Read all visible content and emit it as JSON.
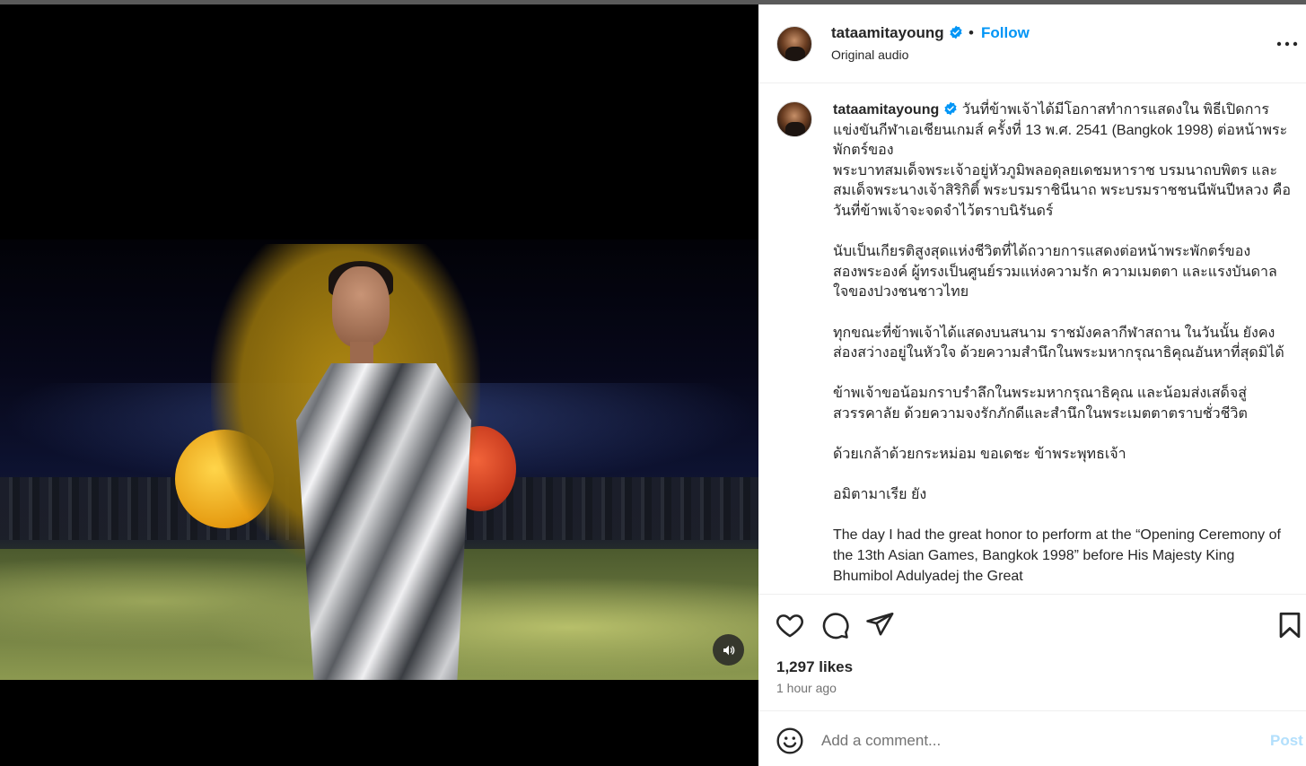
{
  "header": {
    "username": "tataamitayoung",
    "separator": "•",
    "follow_label": "Follow",
    "subtitle": "Original audio"
  },
  "caption": {
    "username": "tataamitayoung",
    "paragraphs": [
      "วันที่ข้าพเจ้าได้มีโอกาสทำการแสดงใน พิธีเปิดการแข่งขันกีฬาเอเชียนเกมส์ ครั้งที่ 13 พ.ศ. 2541 (Bangkok 1998) ต่อหน้าพระพักตร์ของ",
      "พระบาทสมเด็จพระเจ้าอยู่หัวภูมิพลอดุลยเดชมหาราช บรมนาถบพิตร และ สมเด็จพระนางเจ้าสิริกิติ์ พระบรมราชินีนาถ พระบรมราชชนนีพันปีหลวง คือวันที่ข้าพเจ้าจะจดจำไว้ตราบนิรันดร์",
      "นับเป็นเกียรติสูงสุดแห่งชีวิตที่ได้ถวายการแสดงต่อหน้าพระพักตร์ของสองพระองค์ ผู้ทรงเป็นศูนย์รวมแห่งความรัก ความเมตตา และแรงบันดาลใจของปวงชนชาวไทย",
      "ทุกขณะที่ข้าพเจ้าได้แสดงบนสนาม ราชมังคลากีฬาสถาน ในวันนั้น ยังคงส่องสว่างอยู่ในหัวใจ ด้วยความสำนึกในพระมหากรุณาธิคุณอันหาที่สุดมิได้",
      "ข้าพเจ้าขอน้อมกราบรำลึกในพระมหากรุณาธิคุณ และน้อมส่งเสด็จสู่สวรรคาลัย ด้วยความจงรักภักดีและสำนึกในพระเมตตาตราบชั่วชีวิต",
      "ด้วยเกล้าด้วยกระหม่อม ขอเดชะ ข้าพระพุทธเจ้า",
      "อมิตามาเรีย ยัง",
      "The day I had the great honor to perform at the “Opening Ceremony of the 13th Asian Games, Bangkok 1998” before His Majesty King Bhumibol Adulyadej the Great"
    ]
  },
  "actions": {
    "likes": "1,297 likes",
    "time_ago": "1 hour ago"
  },
  "comment": {
    "placeholder": "Add a comment...",
    "post_label": "Post"
  },
  "icons": {
    "verified": "verified-badge-icon",
    "more": "more-options-icon",
    "like": "heart-icon",
    "comment": "comment-bubble-icon",
    "share": "paper-plane-icon",
    "save": "bookmark-icon",
    "emoji": "smiley-icon",
    "sound": "speaker-icon"
  },
  "colors": {
    "accent": "#0095f6",
    "post_disabled": "#b2dffc",
    "verified": "#0095f6",
    "text": "#262626",
    "muted": "#737373"
  }
}
